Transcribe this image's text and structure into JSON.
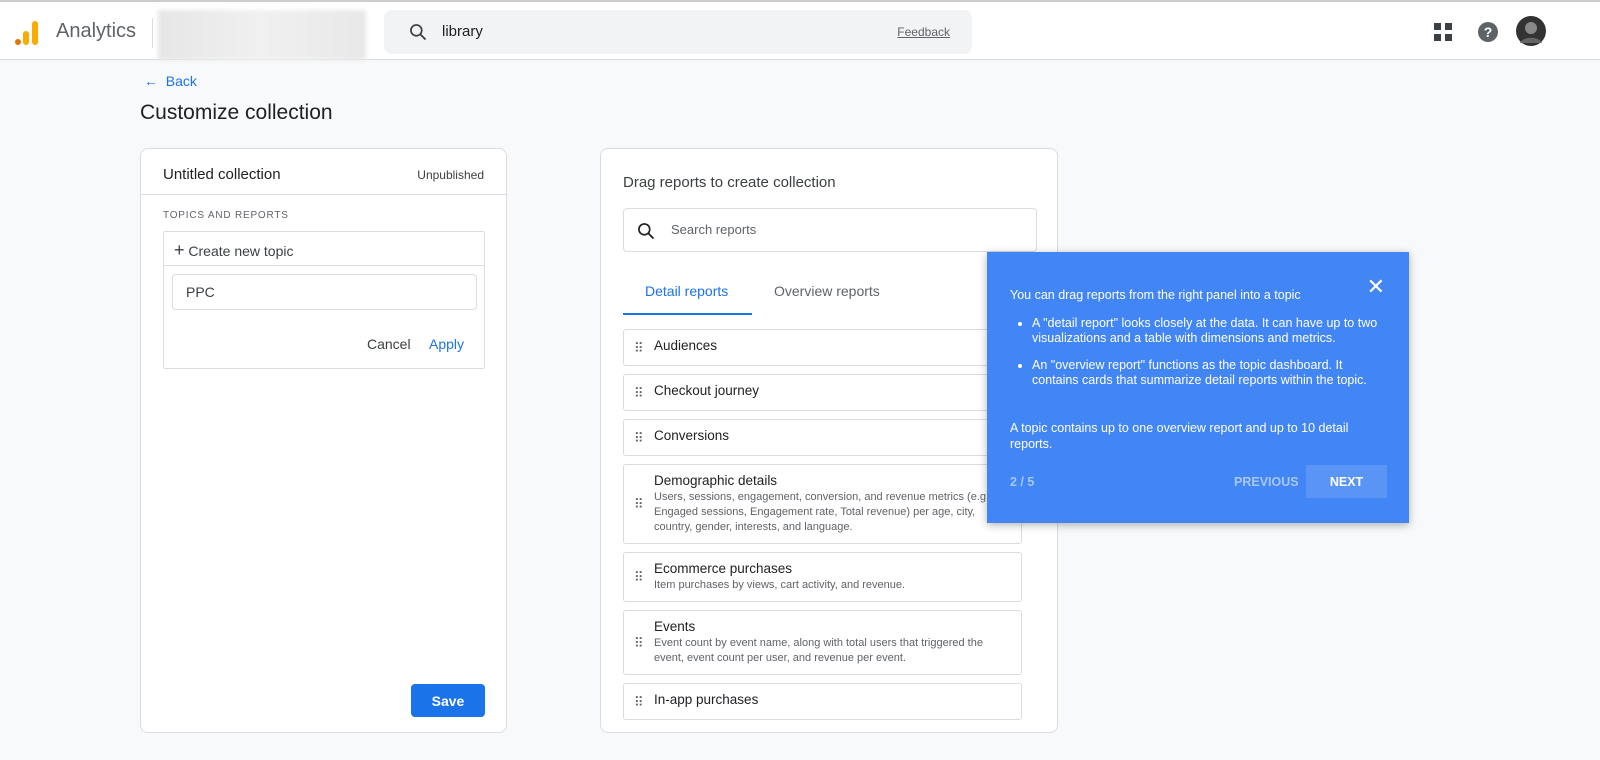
{
  "header": {
    "app_name": "Analytics",
    "search_value": "library",
    "feedback": "Feedback",
    "icons": [
      "apps-grid-icon",
      "help-icon",
      "avatar"
    ]
  },
  "page": {
    "back": "Back",
    "title": "Customize collection"
  },
  "collection": {
    "name": "Untitled collection",
    "status": "Unpublished",
    "section_label": "TOPICS AND REPORTS",
    "create_topic": "Create new topic",
    "topic_input": "PPC",
    "cancel": "Cancel",
    "apply": "Apply",
    "save": "Save"
  },
  "reports": {
    "heading": "Drag reports to create collection",
    "search_placeholder": "Search reports",
    "tabs": [
      {
        "label": "Detail reports",
        "active": true
      },
      {
        "label": "Overview reports",
        "active": false
      }
    ],
    "items": [
      {
        "title": "Audiences",
        "desc": ""
      },
      {
        "title": "Checkout journey",
        "desc": ""
      },
      {
        "title": "Conversions",
        "desc": ""
      },
      {
        "title": "Demographic details",
        "desc": "Users, sessions, engagement, conversion, and revenue metrics (e.g. Engaged sessions, Engagement rate, Total revenue) per age, city, country, gender, interests, and language."
      },
      {
        "title": "Ecommerce purchases",
        "desc": "Item purchases by views, cart activity, and revenue."
      },
      {
        "title": "Events",
        "desc": "Event count by event name, along with total users that triggered the event, event count per user, and revenue per event."
      },
      {
        "title": "In-app purchases",
        "desc": ""
      }
    ]
  },
  "tooltip": {
    "heading": "You can drag reports from the right panel into a topic",
    "bullets": [
      "A \"detail report\" looks closely at the data. It can have up to two visualizations and a table with dimensions and metrics.",
      "An \"overview report\" functions as the topic dashboard. It contains cards that summarize detail reports within the topic."
    ],
    "footer": "A topic contains up to one overview report and up to 10 detail reports.",
    "page": "2 / 5",
    "previous": "PREVIOUS",
    "next": "NEXT",
    "color": "#4285f4"
  }
}
